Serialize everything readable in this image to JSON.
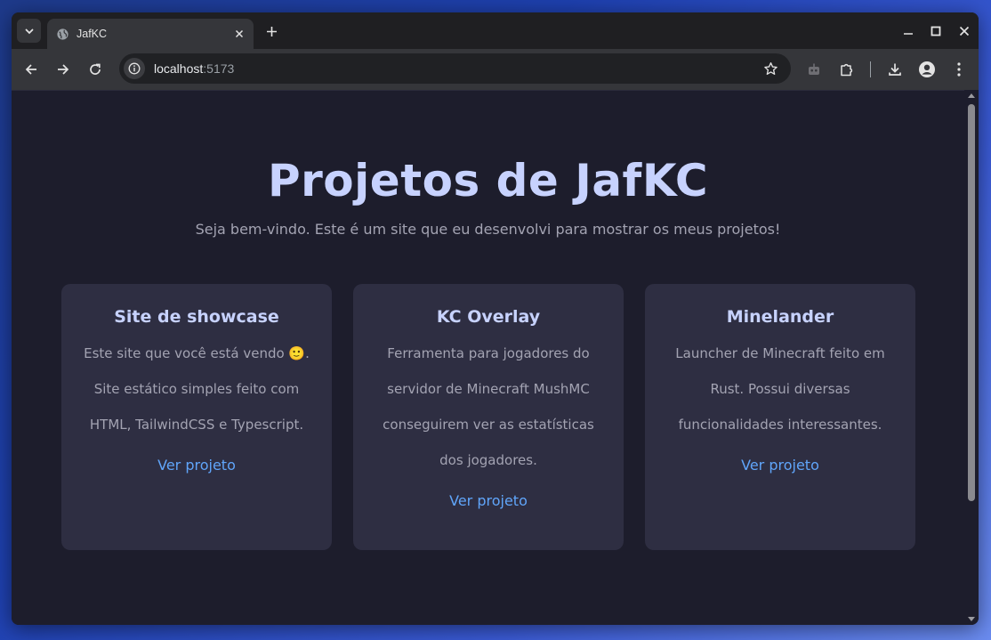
{
  "browser": {
    "tab_title": "JafKC",
    "url_host": "localhost",
    "url_port": ":5173"
  },
  "page": {
    "title": "Projetos de JafKC",
    "subtitle": "Seja bem-vindo. Este é um site que eu desenvolvi para mostrar os meus projetos!"
  },
  "projects": [
    {
      "name": "Site de showcase",
      "description": "Este site que você está vendo 🙂. Site estático simples feito com HTML, TailwindCSS e Typescript.",
      "link_label": "Ver projeto"
    },
    {
      "name": "KC Overlay",
      "description": "Ferramenta para jogadores do servidor de Minecraft MushMC conseguirem ver as estatísticas dos jogadores.",
      "link_label": "Ver projeto"
    },
    {
      "name": "Minelander",
      "description": "Launcher de Minecraft feito em Rust. Possui diversas funcionalidades interessantes.",
      "link_label": "Ver projeto"
    }
  ],
  "colors": {
    "page_bg": "#1d1d2c",
    "card_bg": "#2e2e42",
    "title": "#c7d2fe",
    "body_text": "#a3a3b2",
    "link": "#60a5fa"
  },
  "icons": {
    "tab_search": "chevron-down-icon",
    "favicon": "globe-icon",
    "tab_close": "close-icon",
    "new_tab": "plus-icon",
    "minimize": "minimize-icon",
    "maximize": "maximize-icon",
    "close_window": "close-icon",
    "back": "arrow-left-icon",
    "forward": "arrow-right-icon",
    "reload": "reload-icon",
    "site_info": "info-icon",
    "bookmark": "star-icon",
    "extension_bot": "robot-icon",
    "extensions": "puzzle-icon",
    "downloads": "download-icon",
    "profile": "profile-icon",
    "menu": "kebab-menu-icon"
  }
}
